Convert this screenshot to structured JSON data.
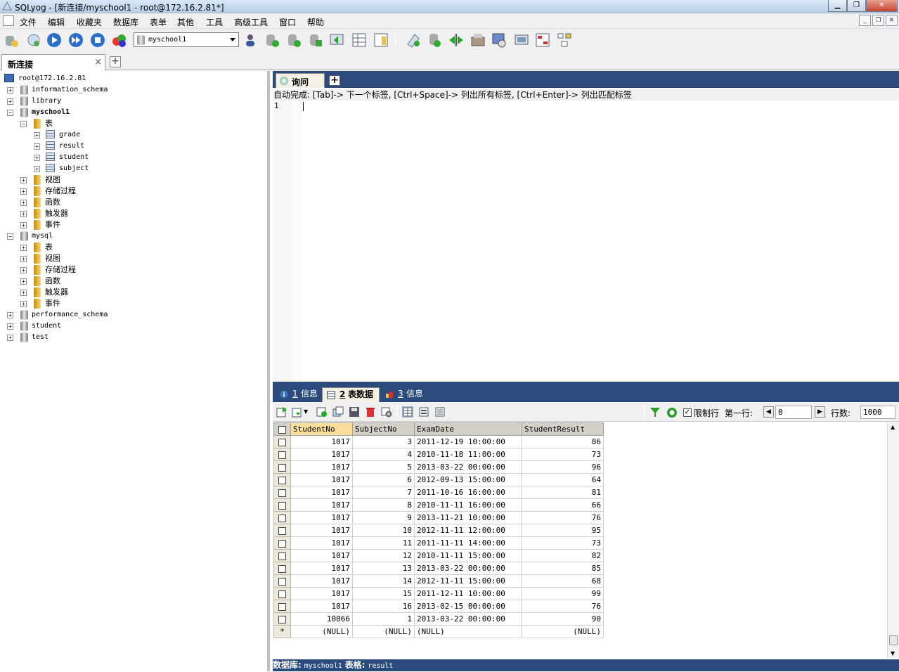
{
  "window": {
    "title": "SQLyog - [新连接/myschool1 - root@172.16.2.81*]"
  },
  "menu": [
    "文件",
    "编辑",
    "收藏夹",
    "数据库",
    "表单",
    "其他",
    "工具",
    "高级工具",
    "窗口",
    "帮助"
  ],
  "toolbar": {
    "database_select": "myschool1"
  },
  "connection_tab": {
    "label": "新连接",
    "close": "×"
  },
  "tree": {
    "server": "root@172.16.2.81",
    "nodes": [
      {
        "label": "information_schema"
      },
      {
        "label": "library"
      },
      {
        "label": "myschool1"
      },
      {
        "label": "表"
      },
      {
        "label": "grade"
      },
      {
        "label": "result"
      },
      {
        "label": "student"
      },
      {
        "label": "subject"
      },
      {
        "label": "视图"
      },
      {
        "label": "存储过程"
      },
      {
        "label": "函数"
      },
      {
        "label": "触发器"
      },
      {
        "label": "事件"
      },
      {
        "label": "mysql"
      },
      {
        "label": "表"
      },
      {
        "label": "视图"
      },
      {
        "label": "存储过程"
      },
      {
        "label": "函数"
      },
      {
        "label": "触发器"
      },
      {
        "label": "事件"
      },
      {
        "label": "performance_schema"
      },
      {
        "label": "student"
      },
      {
        "label": "test"
      }
    ]
  },
  "query": {
    "tab_label": "询问",
    "autocomplete_hint": "自动完成: [Tab]-> 下一个标签, [Ctrl+Space]-> 列出所有标签, [Ctrl+Enter]-> 列出匹配标签",
    "line_number": "1"
  },
  "result_tabs": [
    {
      "num": "1",
      "label": "信息"
    },
    {
      "num": "2",
      "label": "表数据"
    },
    {
      "num": "3",
      "label": "信息"
    }
  ],
  "result_toolbar": {
    "limit_label": "限制行",
    "first_row_label": "第一行:",
    "first_row_value": "0",
    "rows_label": "行数:",
    "rows_value": "1000"
  },
  "grid": {
    "columns": [
      "StudentNo",
      "SubjectNo",
      "ExamDate",
      "StudentResult"
    ],
    "rows": [
      [
        "1017",
        "3",
        "2011-12-19 10:00:00",
        "86"
      ],
      [
        "1017",
        "4",
        "2010-11-18 11:00:00",
        "73"
      ],
      [
        "1017",
        "5",
        "2013-03-22 00:00:00",
        "96"
      ],
      [
        "1017",
        "6",
        "2012-09-13 15:00:00",
        "64"
      ],
      [
        "1017",
        "7",
        "2011-10-16 16:00:00",
        "81"
      ],
      [
        "1017",
        "8",
        "2010-11-11 16:00:00",
        "66"
      ],
      [
        "1017",
        "9",
        "2013-11-21 10:00:00",
        "76"
      ],
      [
        "1017",
        "10",
        "2012-11-11 12:00:00",
        "95"
      ],
      [
        "1017",
        "11",
        "2011-11-11 14:00:00",
        "73"
      ],
      [
        "1017",
        "12",
        "2010-11-11 15:00:00",
        "82"
      ],
      [
        "1017",
        "13",
        "2013-03-22 00:00:00",
        "85"
      ],
      [
        "1017",
        "14",
        "2012-11-11 15:00:00",
        "68"
      ],
      [
        "1017",
        "15",
        "2011-12-11 10:00:00",
        "99"
      ],
      [
        "1017",
        "16",
        "2013-02-15 00:00:00",
        "76"
      ],
      [
        "10066",
        "1",
        "2013-03-22 00:00:00",
        "90"
      ]
    ],
    "new_row": [
      "(NULL)",
      "(NULL)",
      "(NULL)",
      "(NULL)"
    ],
    "new_row_marker": "*"
  },
  "status": {
    "db_label": "数据库:",
    "db_value": "myschool1",
    "table_label": "表格:",
    "table_value": "result"
  }
}
